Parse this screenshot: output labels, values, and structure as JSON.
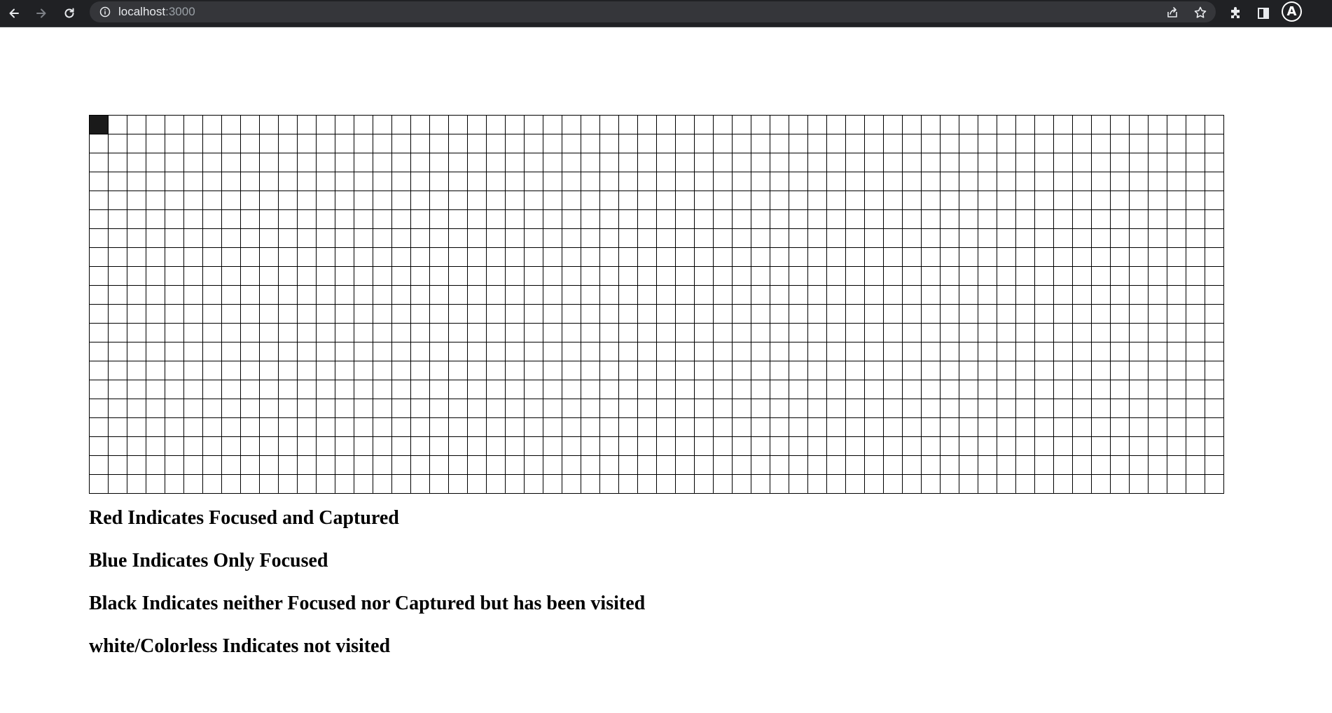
{
  "browser": {
    "url_host": "localhost",
    "url_port": ":3000",
    "avatar_letter": "A",
    "icons": {
      "back": "arrow-left-icon",
      "forward": "arrow-right-icon",
      "reload": "reload-icon",
      "site_info": "info-circle-icon",
      "share": "share-icon",
      "bookmark": "star-icon",
      "extensions": "puzzle-icon",
      "side_panel": "side-panel-icon"
    }
  },
  "grid": {
    "columns": 60,
    "rows": 20,
    "visited_cells": [
      [
        0,
        0
      ]
    ],
    "focused_cells": [],
    "captured_cells": [],
    "colors": {
      "visited": "#1a1a1a",
      "focused": "#1a4fd6",
      "captured": "#d61a1a",
      "unvisited": "#ffffff",
      "border": "#000000"
    }
  },
  "legend": {
    "red": "Red Indicates Focused and Captured",
    "blue": "Blue Indicates Only Focused",
    "black": "Black Indicates neither Focused nor Captured but has been visited",
    "white": "white/Colorless Indicates not visited"
  }
}
